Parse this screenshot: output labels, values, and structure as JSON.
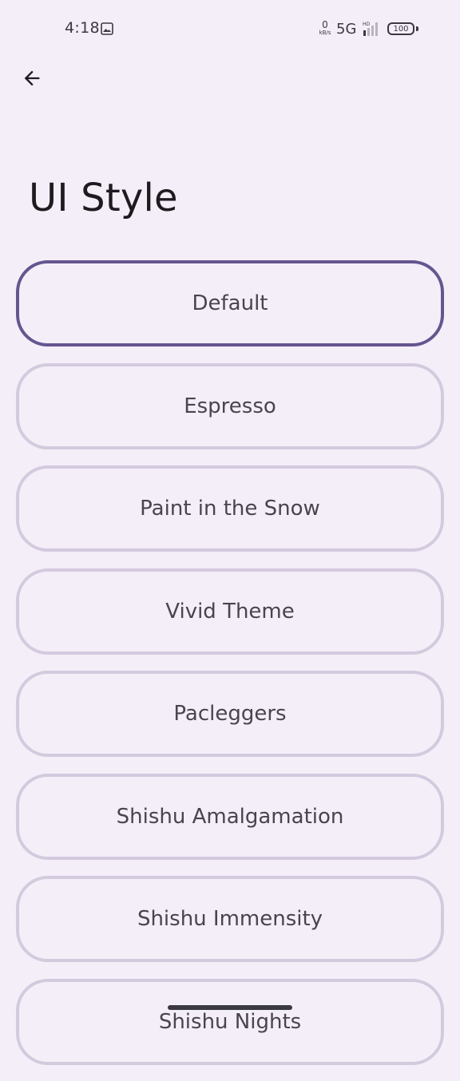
{
  "status_bar": {
    "time": "4:18",
    "image_icon": "image-icon",
    "net_speed_value": "0",
    "net_speed_unit": "kB/s",
    "network": "5G",
    "signal_label": "HD",
    "battery": "100"
  },
  "header": {
    "back_icon": "arrow-back-icon"
  },
  "page": {
    "title": "UI Style"
  },
  "styles": {
    "items": [
      {
        "label": "Default",
        "selected": true
      },
      {
        "label": "Espresso",
        "selected": false
      },
      {
        "label": "Paint in the Snow",
        "selected": false
      },
      {
        "label": "Vivid Theme",
        "selected": false
      },
      {
        "label": "Pacleggers",
        "selected": false
      },
      {
        "label": "Shishu Amalgamation",
        "selected": false
      },
      {
        "label": "Shishu Immensity",
        "selected": false
      },
      {
        "label": "Shishu Nights",
        "selected": false
      }
    ]
  },
  "colors": {
    "background": "#f4eef8",
    "selected_border": "#65558f",
    "unselected_border": "#d4cade",
    "text": "#48454e"
  }
}
